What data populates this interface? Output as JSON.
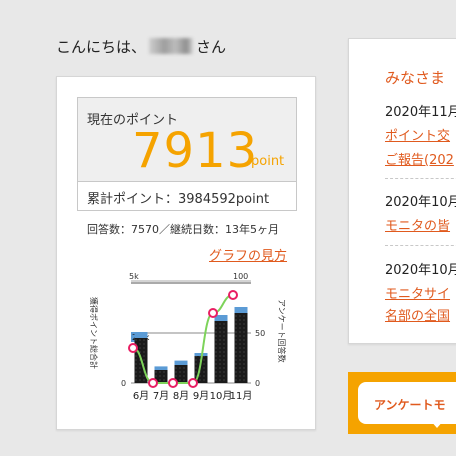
{
  "greeting": {
    "prefix": "こんにちは、",
    "suffix": "さん"
  },
  "points": {
    "current_label": "現在のポイント",
    "current_value": "7913",
    "unit": "point",
    "total_label": "累計ポイント：",
    "total_value": "3984592point"
  },
  "stats": {
    "text": "回答数：7570／継続日数：13年5ヶ月"
  },
  "graph_link": "グラフの見方",
  "chart_data": {
    "type": "bar",
    "categories": [
      "6月",
      "7月",
      "8月",
      "9月",
      "10月",
      "11月"
    ],
    "series": [
      {
        "values": [
          2.25,
          0.65,
          0.9,
          1.35,
          3.1,
          3.5
        ],
        "color": "#1a1a1a"
      },
      {
        "values": [
          0.3,
          0.18,
          0.22,
          0.15,
          0.3,
          0.3
        ],
        "color": "#5b9bd5"
      }
    ],
    "line_series": {
      "axis": "right",
      "values": [
        35,
        0,
        0,
        0,
        70,
        88
      ],
      "color": "#7dd35a",
      "marker": "#e91e63"
    },
    "left_axis": {
      "label": "獲得ポイント総合計",
      "ticks": [
        "0",
        "2.5k",
        "5k"
      ],
      "ylim": [
        0,
        5
      ]
    },
    "right_axis": {
      "label": "アンケート回答数",
      "ticks": [
        "0",
        "50",
        "100"
      ],
      "ylim": [
        0,
        100
      ]
    }
  },
  "news": {
    "title": "みなさま",
    "items": [
      {
        "date": "2020年11月",
        "lines": [
          "ポイント交",
          "ご報告(202"
        ]
      },
      {
        "date": "2020年10月",
        "lines": [
          "モニタの皆"
        ]
      },
      {
        "date": "2020年10月",
        "lines": [
          "モニタサイ",
          "名部の全国"
        ]
      }
    ]
  },
  "survey_banner": {
    "label": "アンケートモ"
  },
  "colors": {
    "accent_orange": "#f5a300",
    "link_orange": "#e05a1e",
    "line_green": "#7dd35a",
    "bar_blue": "#5b9bd5"
  }
}
